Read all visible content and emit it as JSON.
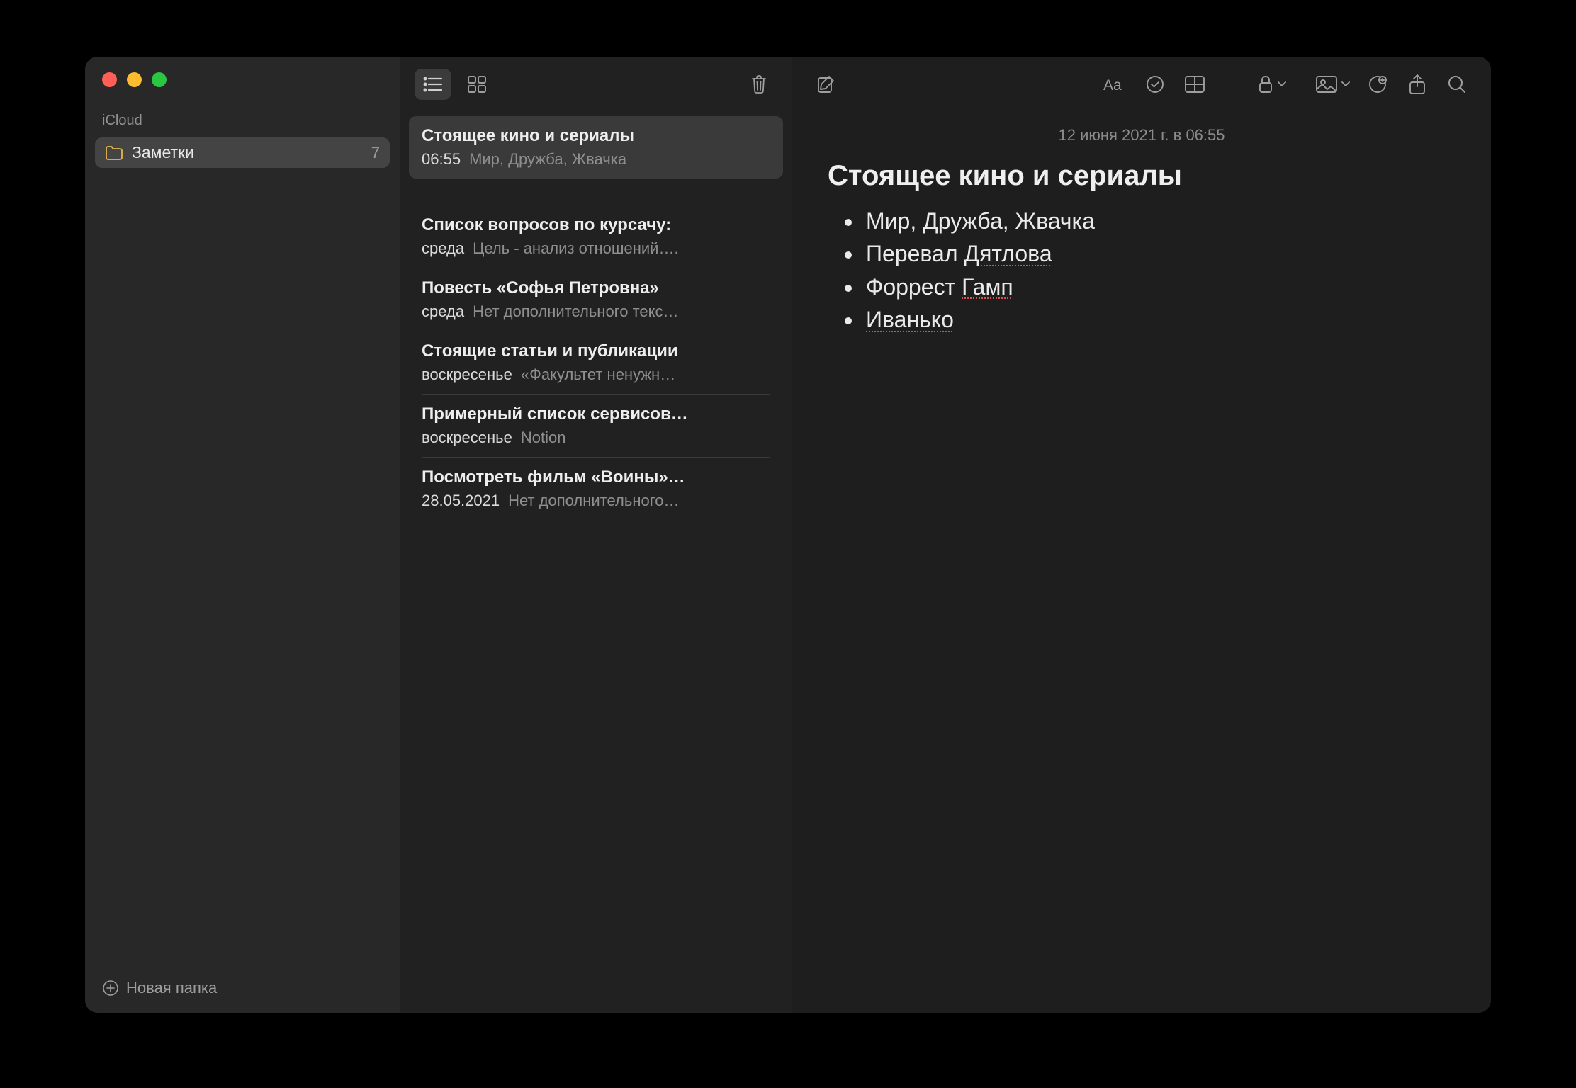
{
  "sidebar": {
    "section_label": "iCloud",
    "folder": {
      "name": "Заметки",
      "count": "7"
    },
    "new_folder_label": "Новая папка"
  },
  "notes": [
    {
      "title": "Стоящее кино и сериалы",
      "date": "06:55",
      "preview": "Мир, Дружба, Жвачка",
      "selected": true
    },
    {
      "title": "Список вопросов по курсачу:",
      "date": "среда",
      "preview": "Цель - анализ отношений…."
    },
    {
      "title": "Повесть «Софья Петровна»",
      "date": "среда",
      "preview": "Нет дополнительного текс…"
    },
    {
      "title": "Стоящие статьи и публикации",
      "date": "воскресенье",
      "preview": "«Факультет ненужн…"
    },
    {
      "title": "Примерный список сервисов…",
      "date": "воскресенье",
      "preview": "Notion"
    },
    {
      "title": "Посмотреть фильм «Воины»…",
      "date": "28.05.2021",
      "preview": "Нет дополнительного…"
    }
  ],
  "editor": {
    "timestamp": "12 июня 2021 г. в 06:55",
    "title": "Стоящее кино и сериалы",
    "bullets": [
      {
        "text": "Мир, Дружба, Жвачка"
      },
      {
        "text_pre": "Перевал ",
        "err": "Дятлова"
      },
      {
        "text_pre": "Форрест ",
        "err": "Гамп"
      },
      {
        "err": "Иванько"
      }
    ]
  }
}
